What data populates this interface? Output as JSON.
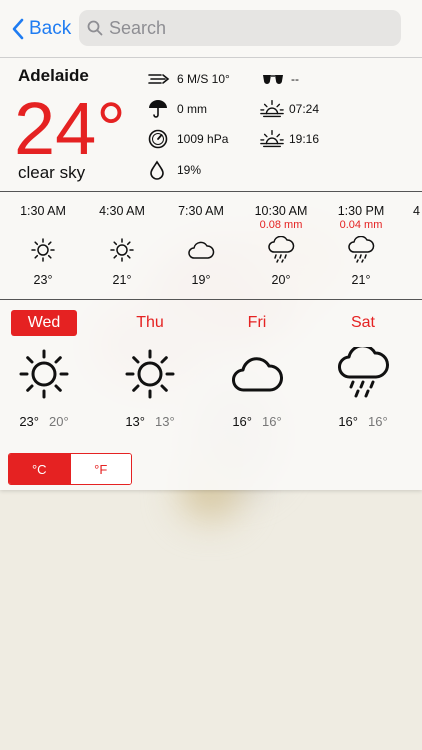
{
  "nav": {
    "back_label": "Back",
    "search_placeholder": "Search"
  },
  "current": {
    "city": "Adelaide",
    "temperature": "24°",
    "condition": "clear sky",
    "wind": "6 M/S 10°",
    "precipitation": "0 mm",
    "pressure": "1009 hPa",
    "humidity": "19%",
    "uv": "--",
    "sunrise": "07:24",
    "sunset": "19:16"
  },
  "hourly": [
    {
      "time": "1:30 AM",
      "precip": "",
      "icon": "sun-icon",
      "temp": "23°"
    },
    {
      "time": "4:30 AM",
      "precip": "",
      "icon": "sun-icon",
      "temp": "21°"
    },
    {
      "time": "7:30 AM",
      "precip": "",
      "icon": "cloud-icon",
      "temp": "19°"
    },
    {
      "time": "10:30 AM",
      "precip": "0.08 mm",
      "icon": "rain-cloud-icon",
      "temp": "20°"
    },
    {
      "time": "1:30 PM",
      "precip": "0.04 mm",
      "icon": "rain-cloud-icon",
      "temp": "21°"
    },
    {
      "time": "4",
      "precip": "",
      "icon": "",
      "temp": ""
    }
  ],
  "daily": [
    {
      "day": "Wed",
      "icon": "sun-icon",
      "high": "23°",
      "low": "20°",
      "selected": true
    },
    {
      "day": "Thu",
      "icon": "sun-icon",
      "high": "13°",
      "low": "13°",
      "selected": false
    },
    {
      "day": "Fri",
      "icon": "cloud-icon",
      "high": "16°",
      "low": "16°",
      "selected": false
    },
    {
      "day": "Sat",
      "icon": "rain-cloud-icon",
      "high": "16°",
      "low": "16°",
      "selected": false
    }
  ],
  "units": {
    "celsius": "°C",
    "fahrenheit": "°F",
    "selected": "celsius"
  },
  "colors": {
    "accent": "#e52222",
    "link": "#1f7cf2"
  }
}
